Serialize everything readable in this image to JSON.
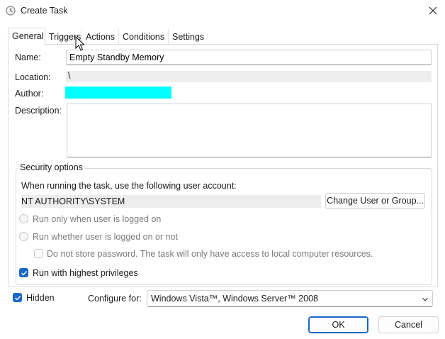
{
  "window": {
    "title": "Create Task",
    "icon": "clock-icon",
    "close_icon": "close-icon"
  },
  "tabs": [
    {
      "label": "General",
      "active": true
    },
    {
      "label": "Triggers",
      "active": false
    },
    {
      "label": "Actions",
      "active": false
    },
    {
      "label": "Conditions",
      "active": false
    },
    {
      "label": "Settings",
      "active": false
    }
  ],
  "general": {
    "name_label": "Name:",
    "name_value": "Empty Standby Memory",
    "location_label": "Location:",
    "location_value": "\\",
    "author_label": "Author:",
    "author_value": "",
    "author_redaction_color": "#00ffff",
    "description_label": "Description:",
    "description_value": ""
  },
  "security": {
    "legend": "Security options",
    "account_prompt": "When running the task, use the following user account:",
    "account_value": "NT AUTHORITY\\SYSTEM",
    "change_user_button": "Change User or Group...",
    "radio_logged_on": {
      "label": "Run only when user is logged on",
      "selected": false,
      "enabled": false
    },
    "radio_whether": {
      "label": "Run whether user is logged on or not",
      "selected": false,
      "enabled": false
    },
    "no_store_password": {
      "label": "Do not store password.  The task will only have access to local computer resources.",
      "checked": false,
      "enabled": false
    },
    "highest_privileges": {
      "label": "Run with highest privileges",
      "checked": true
    }
  },
  "bottom": {
    "hidden": {
      "label": "Hidden",
      "checked": true
    },
    "configure_label": "Configure for:",
    "configure_value": "Windows Vista™, Windows Server™ 2008",
    "ok_button": "OK",
    "cancel_button": "Cancel"
  },
  "colors": {
    "accent": "#1a66c9",
    "disabled_text": "#7a7a7a",
    "readonly_field": "#ededed"
  }
}
